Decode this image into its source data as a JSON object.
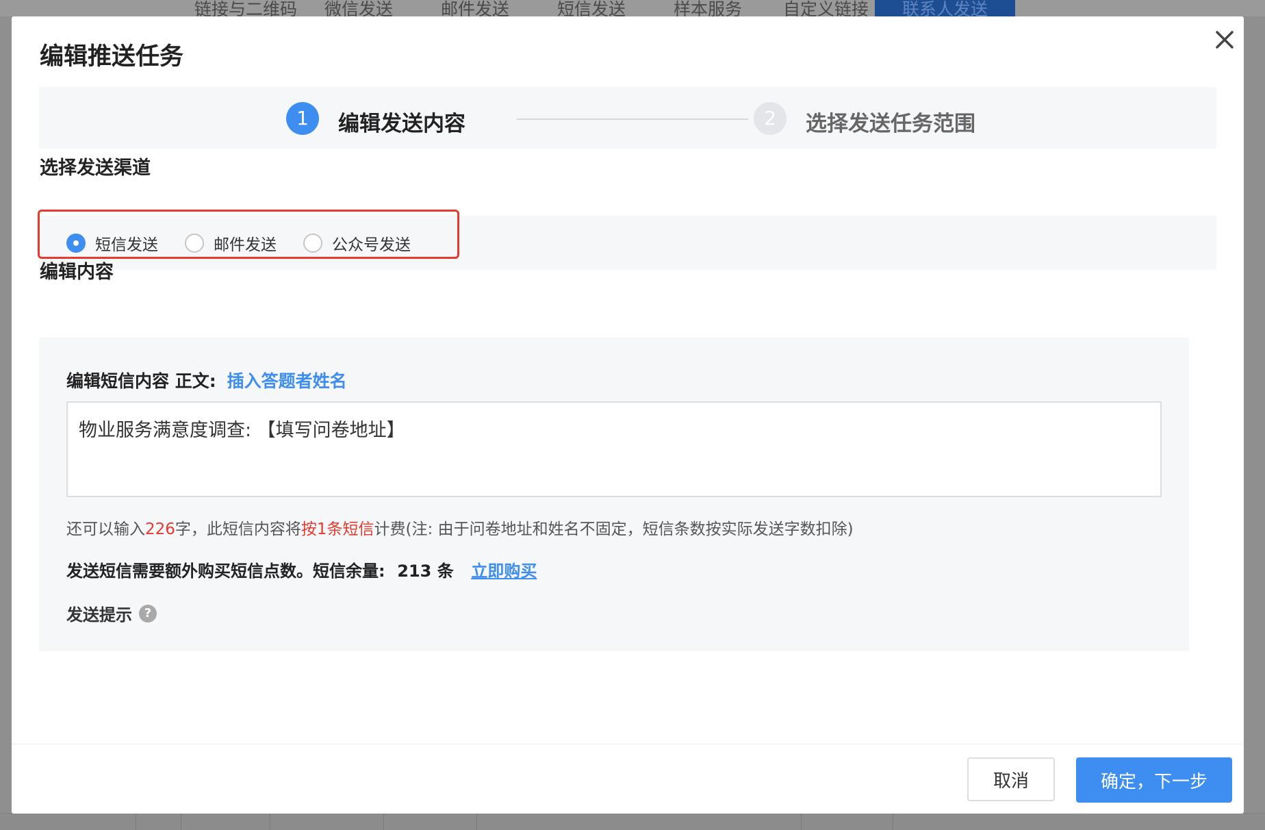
{
  "background": {
    "tabs": [
      "链接与二维码",
      "微信发送",
      "邮件发送",
      "短信发送",
      "样本服务",
      "自定义链接",
      "联系人发送"
    ]
  },
  "modal": {
    "title": "编辑推送任务",
    "close_icon": "close-icon",
    "steps": [
      {
        "number": "1",
        "label": "编辑发送内容"
      },
      {
        "number": "2",
        "label": "选择发送任务范围"
      }
    ],
    "channel_section_title": "选择发送渠道",
    "channels": [
      {
        "label": "短信发送",
        "selected": true
      },
      {
        "label": "邮件发送",
        "selected": false
      },
      {
        "label": "公众号发送",
        "selected": false
      }
    ],
    "content_section_title": "编辑内容",
    "sms": {
      "header_label": "编辑短信内容 正文:",
      "insert_link": "插入答题者姓名",
      "body": "物业服务满意度调查: 【填写问卷地址】",
      "hint_prefix": "还可以输入",
      "hint_count": "226",
      "hint_mid": "字，此短信内容将",
      "hint_billing": "按1条短信",
      "hint_suffix": "计费(注: 由于问卷地址和姓名不固定，短信条数按实际发送字数扣除)",
      "balance_text": "发送短信需要额外购买短信点数。短信余量:",
      "balance_value": "213 条",
      "buy_link": "立即购买",
      "tip_label": "发送提示",
      "help_icon": "?"
    },
    "buttons": {
      "cancel": "取消",
      "next": "确定，下一步"
    }
  }
}
